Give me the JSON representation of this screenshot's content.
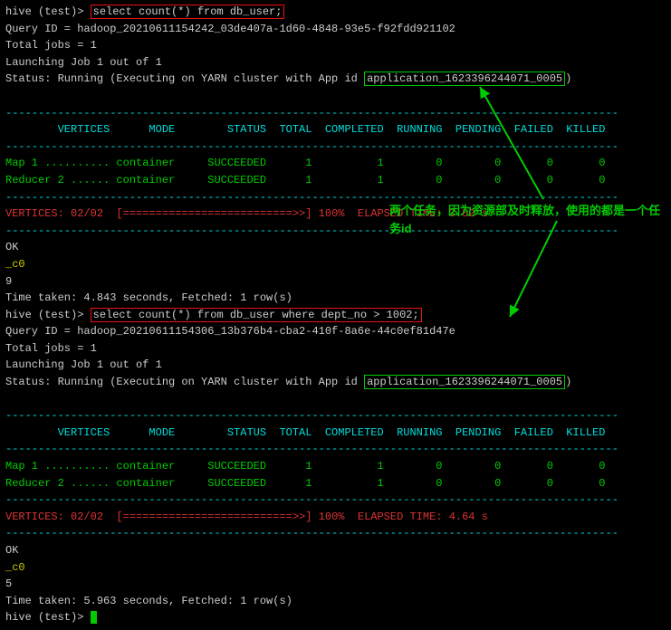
{
  "q1": {
    "prompt_prefix": "hive (test)> ",
    "sql": "select count(*) from db_user;",
    "query_id_line": "Query ID = hadoop_20210611154242_03de407a-1d60-4848-93e5-f92fdd921102",
    "total_jobs": "Total jobs = 1",
    "launching": "Launching Job 1 out of 1",
    "status_prefix": "Status: Running (Executing on YARN cluster with App id ",
    "app_id": "application_1623396244071_0005",
    "status_suffix": ")",
    "dash_top": "----------------------------------------------------------------------------------------------",
    "header": "        VERTICES      MODE        STATUS  TOTAL  COMPLETED  RUNNING  PENDING  FAILED  KILLED",
    "dash_mid": "----------------------------------------------------------------------------------------------",
    "rows": [
      "Map 1 .......... container     SUCCEEDED      1          1        0        0       0       0",
      "Reducer 2 ...... container     SUCCEEDED      1          1        0        0       0       0"
    ],
    "dash_bot": "----------------------------------------------------------------------------------------------",
    "vertices_label": "VERTICES: 02/02  ",
    "progress_bar": "[==========================>>]",
    "progress_suffix": " 100%  ELAPSED TIME: 3.82 s",
    "ok": "OK",
    "col": "_c0",
    "val": "9",
    "time": "Time taken: 4.843 seconds, Fetched: 1 row(s)"
  },
  "q2": {
    "prompt_prefix": "hive (test)> ",
    "sql": "select count(*) from db_user where dept_no > 1002;",
    "query_id_line": "Query ID = hadoop_20210611154306_13b376b4-cba2-410f-8a6e-44c0ef81d47e",
    "total_jobs": "Total jobs = 1",
    "launching": "Launching Job 1 out of 1",
    "status_prefix": "Status: Running (Executing on YARN cluster with App id ",
    "app_id": "application_1623396244071_0005",
    "status_suffix": ")",
    "dash_top": "----------------------------------------------------------------------------------------------",
    "header": "        VERTICES      MODE        STATUS  TOTAL  COMPLETED  RUNNING  PENDING  FAILED  KILLED",
    "dash_mid": "----------------------------------------------------------------------------------------------",
    "rows": [
      "Map 1 .......... container     SUCCEEDED      1          1        0        0       0       0",
      "Reducer 2 ...... container     SUCCEEDED      1          1        0        0       0       0"
    ],
    "dash_bot": "----------------------------------------------------------------------------------------------",
    "vertices_label": "VERTICES: 02/02  ",
    "progress_bar": "[==========================>>]",
    "progress_suffix": " 100%  ELAPSED TIME: 4.64 s",
    "ok": "OK",
    "col": "_c0",
    "val": "5",
    "time": "Time taken: 5.963 seconds, Fetched: 1 row(s)",
    "next_prompt": "hive (test)>"
  },
  "annotation": {
    "text": "两个任务，因为资源部及时释放，使用的都是一个任务id"
  }
}
